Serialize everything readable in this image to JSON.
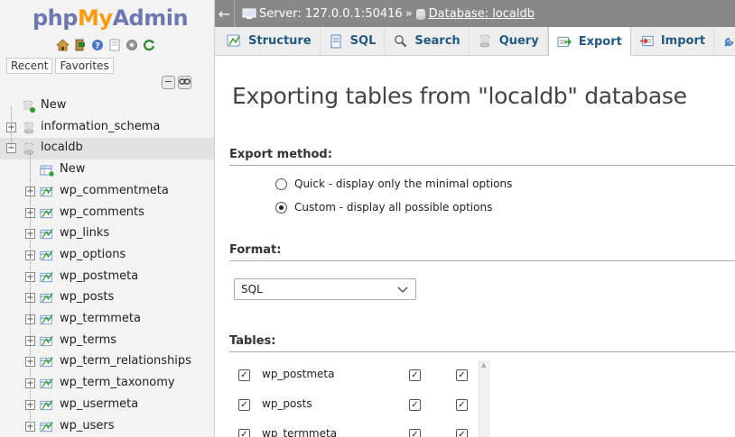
{
  "nav": {
    "logo": {
      "php": "php",
      "my": "My",
      "admin": "Admin"
    },
    "tabs": [
      "Recent",
      "Favorites"
    ],
    "tree": [
      {
        "label": "New",
        "type": "new",
        "level": 0
      },
      {
        "label": "information_schema",
        "type": "db",
        "level": 0
      },
      {
        "label": "localdb",
        "type": "db",
        "level": 0,
        "selected": true
      },
      {
        "label": "New",
        "type": "new",
        "level": 1
      },
      {
        "label": "wp_commentmeta",
        "type": "table",
        "level": 1
      },
      {
        "label": "wp_comments",
        "type": "table",
        "level": 1
      },
      {
        "label": "wp_links",
        "type": "table",
        "level": 1
      },
      {
        "label": "wp_options",
        "type": "table",
        "level": 1
      },
      {
        "label": "wp_postmeta",
        "type": "table",
        "level": 1
      },
      {
        "label": "wp_posts",
        "type": "table",
        "level": 1
      },
      {
        "label": "wp_termmeta",
        "type": "table",
        "level": 1
      },
      {
        "label": "wp_terms",
        "type": "table",
        "level": 1
      },
      {
        "label": "wp_term_relationships",
        "type": "table",
        "level": 1
      },
      {
        "label": "wp_term_taxonomy",
        "type": "table",
        "level": 1
      },
      {
        "label": "wp_usermeta",
        "type": "table",
        "level": 1
      },
      {
        "label": "wp_users",
        "type": "table",
        "level": 1
      }
    ]
  },
  "breadcrumb": {
    "server": "Server: 127.0.0.1:50416",
    "separator": "»",
    "database": "Database: localdb"
  },
  "tabs": [
    {
      "label": "Structure",
      "icon": "structure-icon"
    },
    {
      "label": "SQL",
      "icon": "sql-icon"
    },
    {
      "label": "Search",
      "icon": "search-icon"
    },
    {
      "label": "Query",
      "icon": "query-icon"
    },
    {
      "label": "Export",
      "icon": "export-icon",
      "active": true
    },
    {
      "label": "Import",
      "icon": "import-icon"
    },
    {
      "label": "",
      "icon": "wrench-icon"
    }
  ],
  "main": {
    "title": "Exporting tables from \"localdb\" database",
    "export_method": {
      "heading": "Export method:",
      "options": [
        {
          "label": "Quick - display only the minimal options",
          "selected": false
        },
        {
          "label": "Custom - display all possible options",
          "selected": true
        }
      ]
    },
    "format": {
      "heading": "Format:",
      "selected": "SQL"
    },
    "tables": {
      "heading": "Tables:",
      "rows": [
        {
          "name": "wp_postmeta",
          "checked": true,
          "structure": true,
          "data": true
        },
        {
          "name": "wp_posts",
          "checked": true,
          "structure": true,
          "data": true
        },
        {
          "name": "wp_termmeta",
          "checked": true,
          "structure": true,
          "data": true
        }
      ]
    }
  },
  "colors": {
    "logo_blue": "#6c78af",
    "logo_orange": "#f89c0e",
    "topbar": "#888888",
    "tab_text": "#235a81"
  }
}
